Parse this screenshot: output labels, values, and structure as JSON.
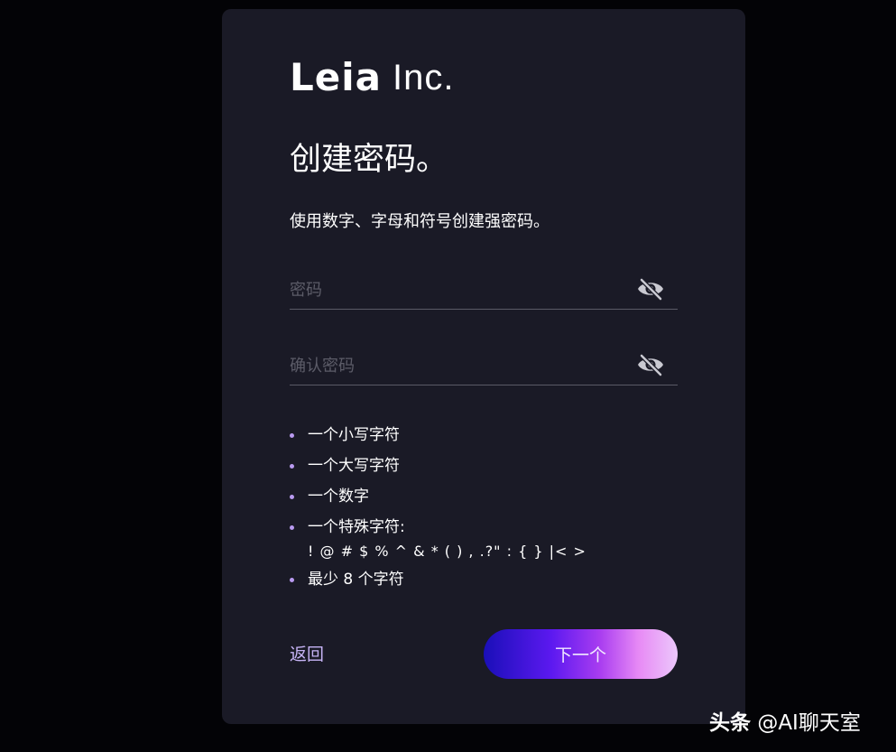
{
  "logo": {
    "brand": "Leia",
    "suffix": "Inc."
  },
  "page": {
    "title": "创建密码。",
    "subtitle": "使用数字、字母和符号创建强密码。"
  },
  "fields": {
    "password": {
      "placeholder": "密码",
      "value": "",
      "toggle_icon": "eye-slash-icon"
    },
    "confirm": {
      "placeholder": "确认密码",
      "value": "",
      "toggle_icon": "eye-slash-icon"
    }
  },
  "requirements": {
    "lowercase": "一个小写字符",
    "uppercase": "一个大写字符",
    "number": "一个数字",
    "special": "一个特殊字符:",
    "special_chars": "! @ # $ % ^ & * ( ) , .?\" : { } |< >",
    "min_length": "最少 8 个字符"
  },
  "actions": {
    "back": "返回",
    "next": "下一个"
  },
  "watermark": {
    "brand": "头条",
    "handle": "@AI聊天室"
  },
  "colors": {
    "background": "#030306",
    "card": "#1a1a26",
    "bullet": "#b99af0",
    "link": "#c6b3f5",
    "button_gradient_start": "#1a0fb8",
    "button_gradient_end": "#ecc8fb"
  }
}
